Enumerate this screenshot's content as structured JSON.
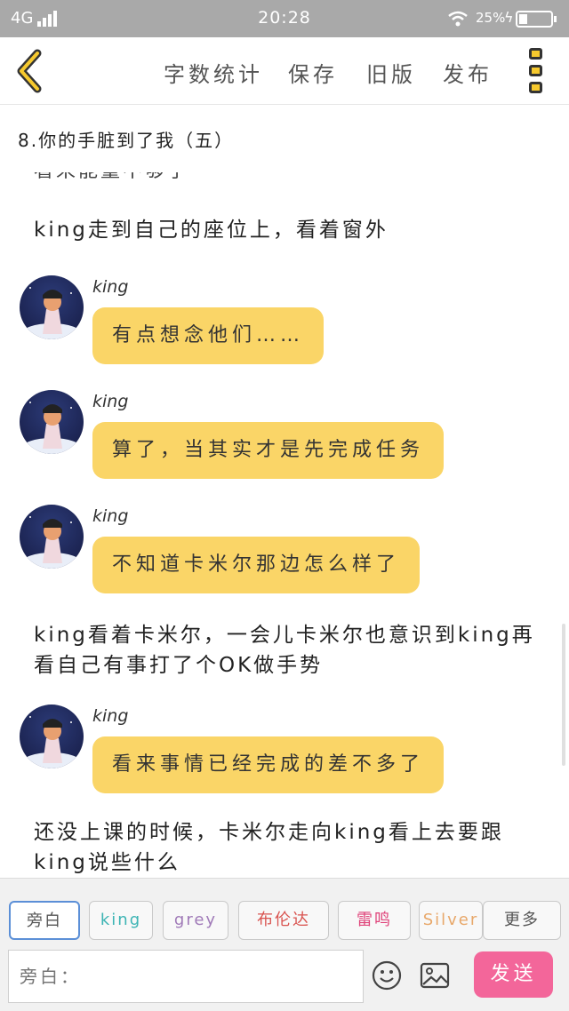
{
  "status_bar": {
    "network": "4G",
    "time": "20:28",
    "battery": "25%",
    "battery_level": 0.25
  },
  "toolbar": {
    "word_count": "字数统计",
    "save": "保存",
    "old_version": "旧版",
    "publish": "发布"
  },
  "chapter_title": "8.你的手脏到了我（五）",
  "story": {
    "cut_line": "看来能量不够了",
    "narration_1": "king走到自己的座位上，看着窗外",
    "messages": [
      {
        "speaker": "king",
        "text": "有点想念他们……"
      },
      {
        "speaker": "king",
        "text": "算了，当其实才是先完成任务"
      },
      {
        "speaker": "king",
        "text": "不知道卡米尔那边怎么样了"
      },
      {
        "speaker": "king",
        "text": "看来事情已经完成的差不多了"
      }
    ],
    "narration_2": "king看着卡米尔，一会儿卡米尔也意识到king再看自己有事打了个OK做手势",
    "narration_3": "还没上课的时候，卡米尔走向king看上去要跟king说些什么"
  },
  "characters": [
    {
      "label": "旁白",
      "color": "#555555"
    },
    {
      "label": "king",
      "color": "#3cb4b4"
    },
    {
      "label": "grey",
      "color": "#a07ab8"
    },
    {
      "label": "布伦达",
      "color": "#d9534f"
    },
    {
      "label": "雷鸣",
      "color": "#e0457b"
    },
    {
      "label": "Silver",
      "color": "#e8a86a"
    },
    {
      "label": "更多",
      "color": "#555555"
    }
  ],
  "input": {
    "placeholder": "旁白："
  },
  "send_label": "发送",
  "colors": {
    "bubble": "#fad567",
    "send": "#f3669a",
    "accent_yellow": "#f6c92e"
  }
}
